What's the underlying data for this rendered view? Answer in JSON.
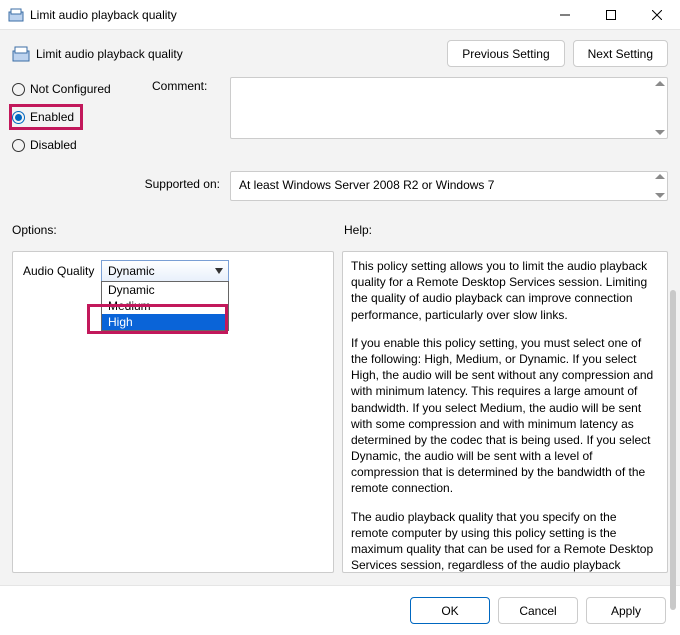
{
  "window": {
    "title": "Limit audio playback quality"
  },
  "subheader": {
    "title": "Limit audio playback quality"
  },
  "nav": {
    "previous": "Previous Setting",
    "next": "Next Setting"
  },
  "state": {
    "not_configured": "Not Configured",
    "enabled": "Enabled",
    "disabled": "Disabled",
    "selected": "enabled"
  },
  "labels": {
    "comment": "Comment:",
    "supported_on": "Supported on:",
    "options": "Options:",
    "help": "Help:",
    "audio_quality": "Audio Quality"
  },
  "supported_on_text": "At least Windows Server 2008 R2 or Windows 7",
  "audio_quality": {
    "value": "Dynamic",
    "options": [
      "Dynamic",
      "Medium",
      "High"
    ],
    "highlighted": "High"
  },
  "help_text": {
    "p1": "This policy setting allows you to limit the audio playback quality for a Remote Desktop Services session. Limiting the quality of audio playback can improve connection performance, particularly over slow links.",
    "p2": "If you enable this policy setting, you must select one of the following:  High, Medium, or Dynamic. If you select High, the audio will be sent without any compression and with minimum latency. This requires a large amount of bandwidth. If you select Medium, the audio will be sent with some compression and with minimum latency as determined by the codec that is being used. If you select Dynamic, the audio will be sent with a level of compression that is determined by the bandwidth of the remote connection.",
    "p3": "The audio playback quality that you specify on the remote computer by using this policy setting is the maximum quality that can be used for a Remote Desktop Services session, regardless of the audio playback quality configured on the client computer.  For example, if the audio playback quality configured on the client computer is higher than the audio playback quality"
  },
  "footer": {
    "ok": "OK",
    "cancel": "Cancel",
    "apply": "Apply"
  }
}
